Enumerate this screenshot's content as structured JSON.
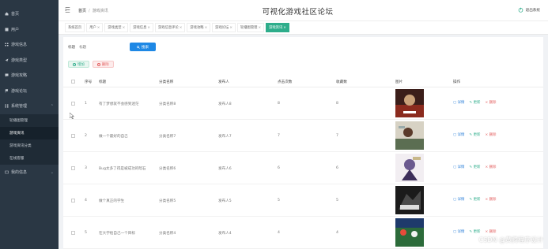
{
  "sidebar": {
    "items": [
      {
        "label": "首页",
        "icon": "home-icon"
      },
      {
        "label": "用户",
        "icon": "users-icon"
      },
      {
        "label": "游戏信息",
        "icon": "grid-icon"
      },
      {
        "label": "游戏类型",
        "icon": "send-icon"
      },
      {
        "label": "游戏攻略",
        "icon": "chat-icon"
      },
      {
        "label": "游戏论坛",
        "icon": "flag-icon"
      },
      {
        "label": "系统管理",
        "icon": "apps-icon"
      }
    ],
    "sub_items": [
      "轮播图管理",
      "游戏资讯",
      "游戏资讯分类",
      "在线客服"
    ],
    "last_item": {
      "label": "我的信息",
      "icon": "profile-icon"
    }
  },
  "header": {
    "breadcrumb_home": "首页",
    "breadcrumb_current": "游戏资讯",
    "title": "可视化游戏社区论坛",
    "logout": "退出系统"
  },
  "tabs": [
    "系统首页",
    "用户",
    "游戏类型",
    "游戏信息",
    "游戏信息评论",
    "游戏攻略",
    "游戏论坛",
    "轮播图管理",
    "游戏资讯"
  ],
  "search": {
    "label": "标题",
    "placeholder": "标题",
    "button": "搜索"
  },
  "actions": {
    "add": "增加",
    "delete": "删除"
  },
  "table": {
    "headers": [
      "序号",
      "标题",
      "分类名称",
      "发布人",
      "点击次数",
      "收藏数",
      "图片",
      "操作"
    ],
    "rows": [
      {
        "no": "1",
        "title": "有了梦想就不会感到迷茫",
        "category": "分类名称8",
        "publisher": "发布人8",
        "clicks": "8",
        "favorites": "8"
      },
      {
        "no": "2",
        "title": "做一个最好的自己",
        "category": "分类名称7",
        "publisher": "发布人7",
        "clicks": "7",
        "favorites": "7"
      },
      {
        "no": "3",
        "title": "Bug太多了得是被成功的暗石",
        "category": "分类名称6",
        "publisher": "发布人6",
        "clicks": "6",
        "favorites": "6"
      },
      {
        "no": "4",
        "title": "做个真正的学生",
        "category": "分类名称5",
        "publisher": "发布人5",
        "clicks": "5",
        "favorites": "5"
      },
      {
        "no": "5",
        "title": "在大学给自己一个目标",
        "category": "分类名称4",
        "publisher": "发布人4",
        "clicks": "4",
        "favorites": "4"
      }
    ],
    "ops": {
      "detail": "详情",
      "edit": "更新",
      "remove": "删除"
    }
  },
  "watermark": "CSDN @黄腾程序设计",
  "colors": {
    "sidebar": "#2a3744",
    "accent": "#2ead8b",
    "primary": "#1e88e5",
    "danger": "#e25a5a"
  }
}
